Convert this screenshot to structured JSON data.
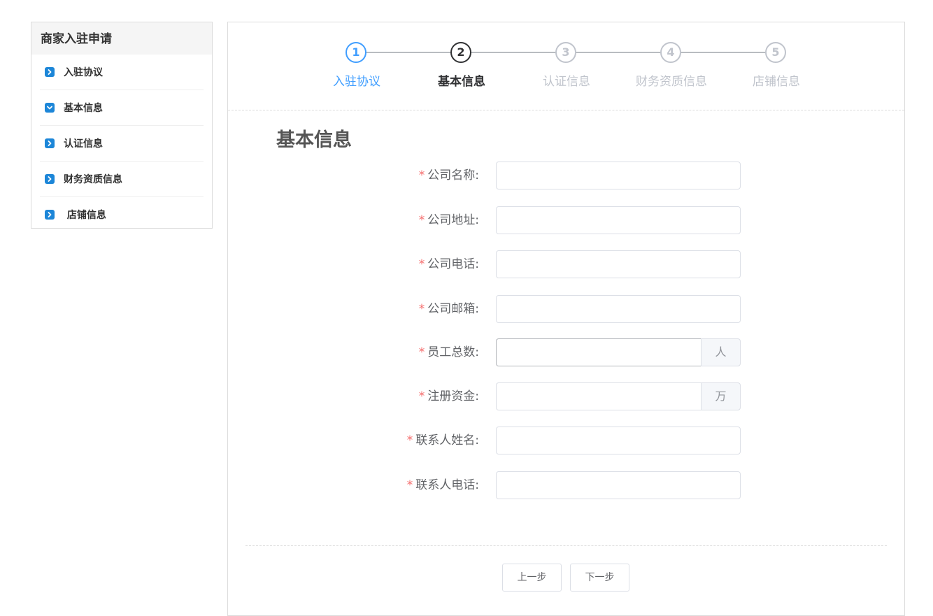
{
  "sidebar": {
    "title": "商家入驻申请",
    "items": [
      {
        "label": "入驻协议",
        "icon": "chevron-right-icon"
      },
      {
        "label": "基本信息",
        "icon": "chevron-down-icon"
      },
      {
        "label": "认证信息",
        "icon": "chevron-right-icon"
      },
      {
        "label": "财务资质信息",
        "icon": "chevron-right-icon"
      },
      {
        "label": " 店铺信息",
        "icon": "chevron-right-icon"
      }
    ]
  },
  "steps": [
    {
      "number": "1",
      "label": "入驻协议",
      "state": "done"
    },
    {
      "number": "2",
      "label": "基本信息",
      "state": "active"
    },
    {
      "number": "3",
      "label": "认证信息",
      "state": "pending"
    },
    {
      "number": "4",
      "label": "财务资质信息",
      "state": "pending"
    },
    {
      "number": "5",
      "label": "店铺信息",
      "state": "pending"
    }
  ],
  "form": {
    "title": "基本信息",
    "required_mark": "*",
    "fields": [
      {
        "label": "公司名称:",
        "value": ""
      },
      {
        "label": "公司地址:",
        "value": ""
      },
      {
        "label": "公司电话:",
        "value": ""
      },
      {
        "label": "公司邮箱:",
        "value": ""
      },
      {
        "label": "员工总数:",
        "value": "",
        "append": "人"
      },
      {
        "label": "注册资金:",
        "value": "",
        "append": "万"
      },
      {
        "label": "联系人姓名:",
        "value": ""
      },
      {
        "label": "联系人电话:",
        "value": ""
      }
    ]
  },
  "buttons": {
    "prev": "上一步",
    "next": "下一步"
  },
  "colors": {
    "primary": "#409eff",
    "sidebar_icon": "#1c86d8",
    "required": "#f56c6c",
    "active_step": "#303133",
    "pending_step": "#c0c4cc"
  }
}
